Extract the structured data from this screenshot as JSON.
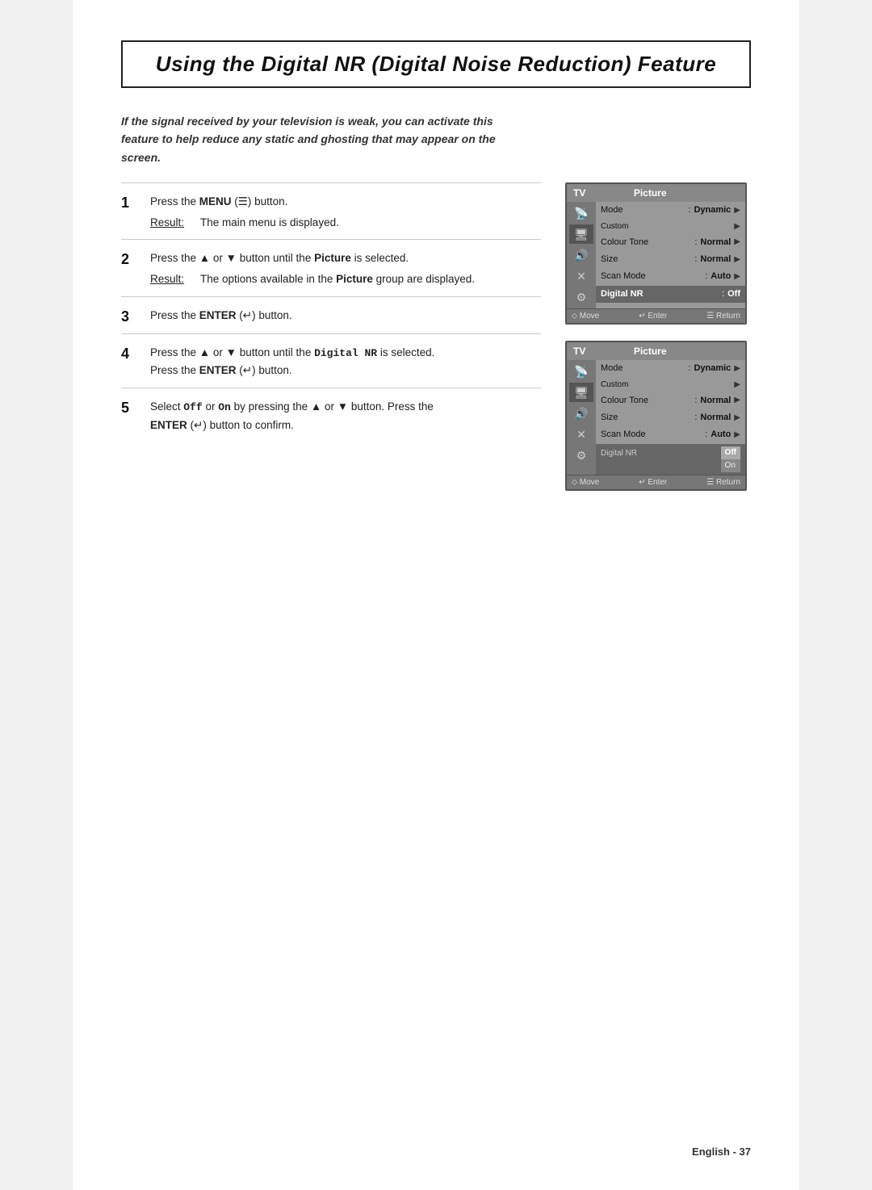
{
  "page": {
    "title": "Using the Digital NR (Digital Noise Reduction) Feature",
    "intro": "If the signal received by your television is weak, you can activate this feature to help reduce any static and ghosting that may appear on the screen.",
    "steps": [
      {
        "number": "1",
        "instruction_pre": "Press the ",
        "instruction_bold": "MENU",
        "instruction_symbol": " (☰) ",
        "instruction_post": " button.",
        "result_label": "Result:",
        "result_text": "The main menu is displayed."
      },
      {
        "number": "2",
        "instruction": "Press the ▲ or ▼ button until the Picture is selected.",
        "result_label": "Result:",
        "result_text": "The options available in the Picture group are displayed."
      },
      {
        "number": "3",
        "instruction_pre": "Press the ",
        "instruction_bold": "ENTER",
        "instruction_symbol": " (↵) ",
        "instruction_post": " button."
      },
      {
        "number": "4",
        "instruction": "Press the ▲ or ▼ button until the Digital NR is selected. Press the ENTER (↵) button."
      },
      {
        "number": "5",
        "instruction": "Select Off or On by pressing the ▲ or ▼ button. Press the ENTER (↵) button to confirm."
      }
    ],
    "screenshot1": {
      "tv_label": "TV",
      "section": "Picture",
      "rows": [
        {
          "label": "Mode",
          "value": "Dynamic",
          "has_arrow": true
        },
        {
          "label": "Custom",
          "value": "",
          "has_arrow": true
        },
        {
          "label": "Colour Tone",
          "value": "Normal",
          "has_arrow": true
        },
        {
          "label": "Size",
          "value": "Normal",
          "has_arrow": true
        },
        {
          "label": "Scan Mode",
          "value": "Auto",
          "has_arrow": true
        },
        {
          "label": "Digital NR",
          "value": "Off",
          "has_arrow": false,
          "highlighted": true
        }
      ],
      "footer": {
        "move": "Move",
        "enter": "Enter",
        "return": "Return"
      }
    },
    "screenshot2": {
      "tv_label": "TV",
      "section": "Picture",
      "rows": [
        {
          "label": "Mode",
          "value": "Dynamic",
          "has_arrow": true
        },
        {
          "label": "Custom",
          "value": "",
          "has_arrow": true
        },
        {
          "label": "Colour Tone",
          "value": "Normal",
          "has_arrow": true
        },
        {
          "label": "Size",
          "value": "Normal",
          "has_arrow": true
        },
        {
          "label": "Scan Mode",
          "value": "Auto",
          "has_arrow": true
        },
        {
          "label": "Digital NR",
          "value": "",
          "dropdown": [
            "Off",
            "On"
          ],
          "highlighted": true
        }
      ],
      "footer": {
        "move": "Move",
        "enter": "Enter",
        "return": "Return"
      }
    },
    "footer": "English - 37"
  }
}
